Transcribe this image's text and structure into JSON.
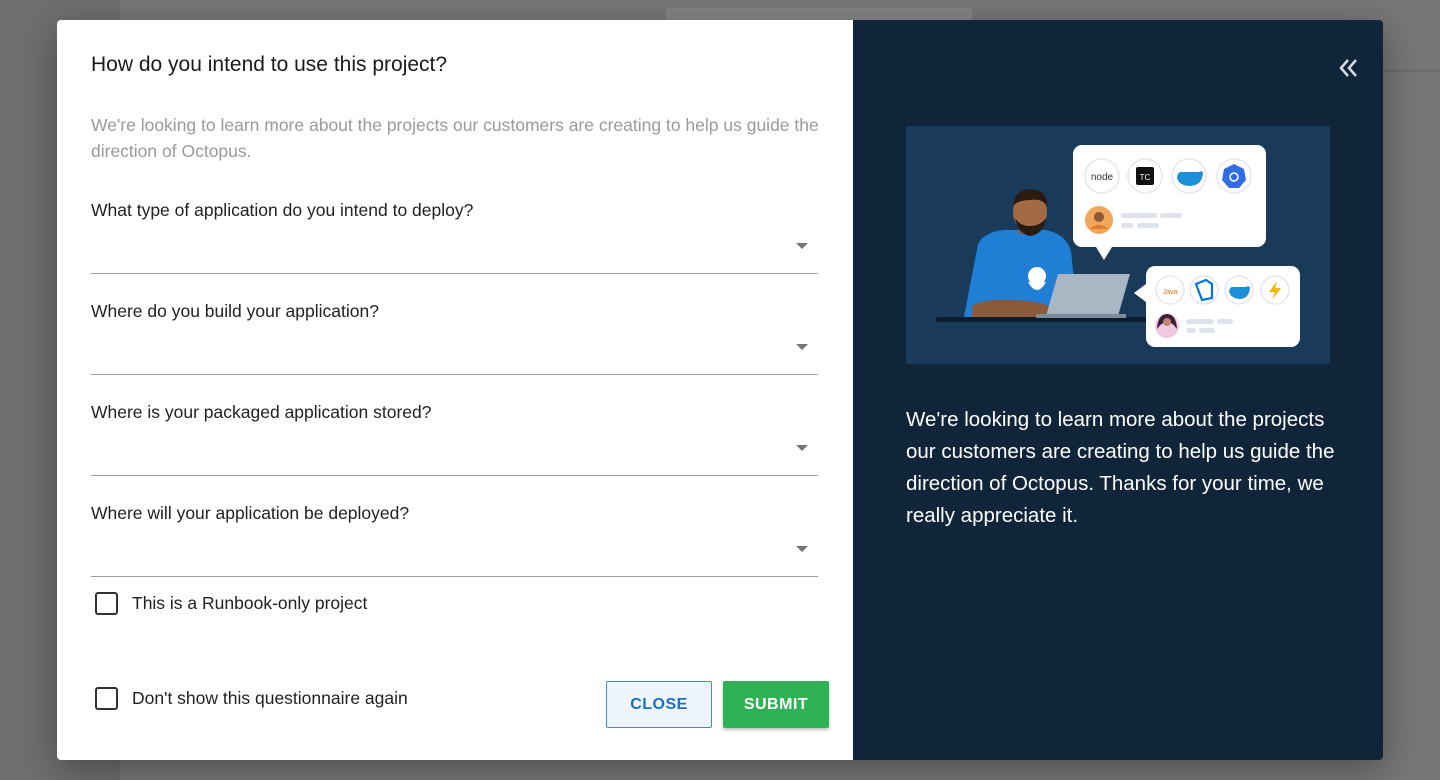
{
  "dialog": {
    "title": "How do you intend to use this project?",
    "subtitle": "We're looking to learn more about the projects our customers are creating to help us guide the direction of Octopus.",
    "fields": [
      {
        "label": "What type of application do you intend to deploy?",
        "value": ""
      },
      {
        "label": "Where do you build your application?",
        "value": ""
      },
      {
        "label": "Where is your packaged application stored?",
        "value": ""
      },
      {
        "label": "Where will your application be deployed?",
        "value": ""
      }
    ],
    "runbook_checkbox": {
      "label": "This is a Runbook-only project",
      "checked": false
    },
    "dont_show_checkbox": {
      "label": "Don't show this questionnaire again",
      "checked": false
    },
    "close_label": "CLOSE",
    "submit_label": "SUBMIT"
  },
  "side_panel": {
    "collapse_icon": "double-chevron-left-icon",
    "message": "We're looking to learn more about the projects our customers are creating to help us guide the direction of Octopus. Thanks for your time, we really appreciate it.",
    "illustration_icons_top": [
      "node",
      "TC",
      "docker",
      "kubernetes"
    ],
    "illustration_icons_bottom": [
      "java",
      "azure-devops",
      "docker",
      "azure-functions"
    ]
  },
  "colors": {
    "panel_bg": "#11253a",
    "illustration_bg": "#1a3a5a",
    "submit_green": "#2fb255",
    "close_blue": "#1a6fc5"
  }
}
